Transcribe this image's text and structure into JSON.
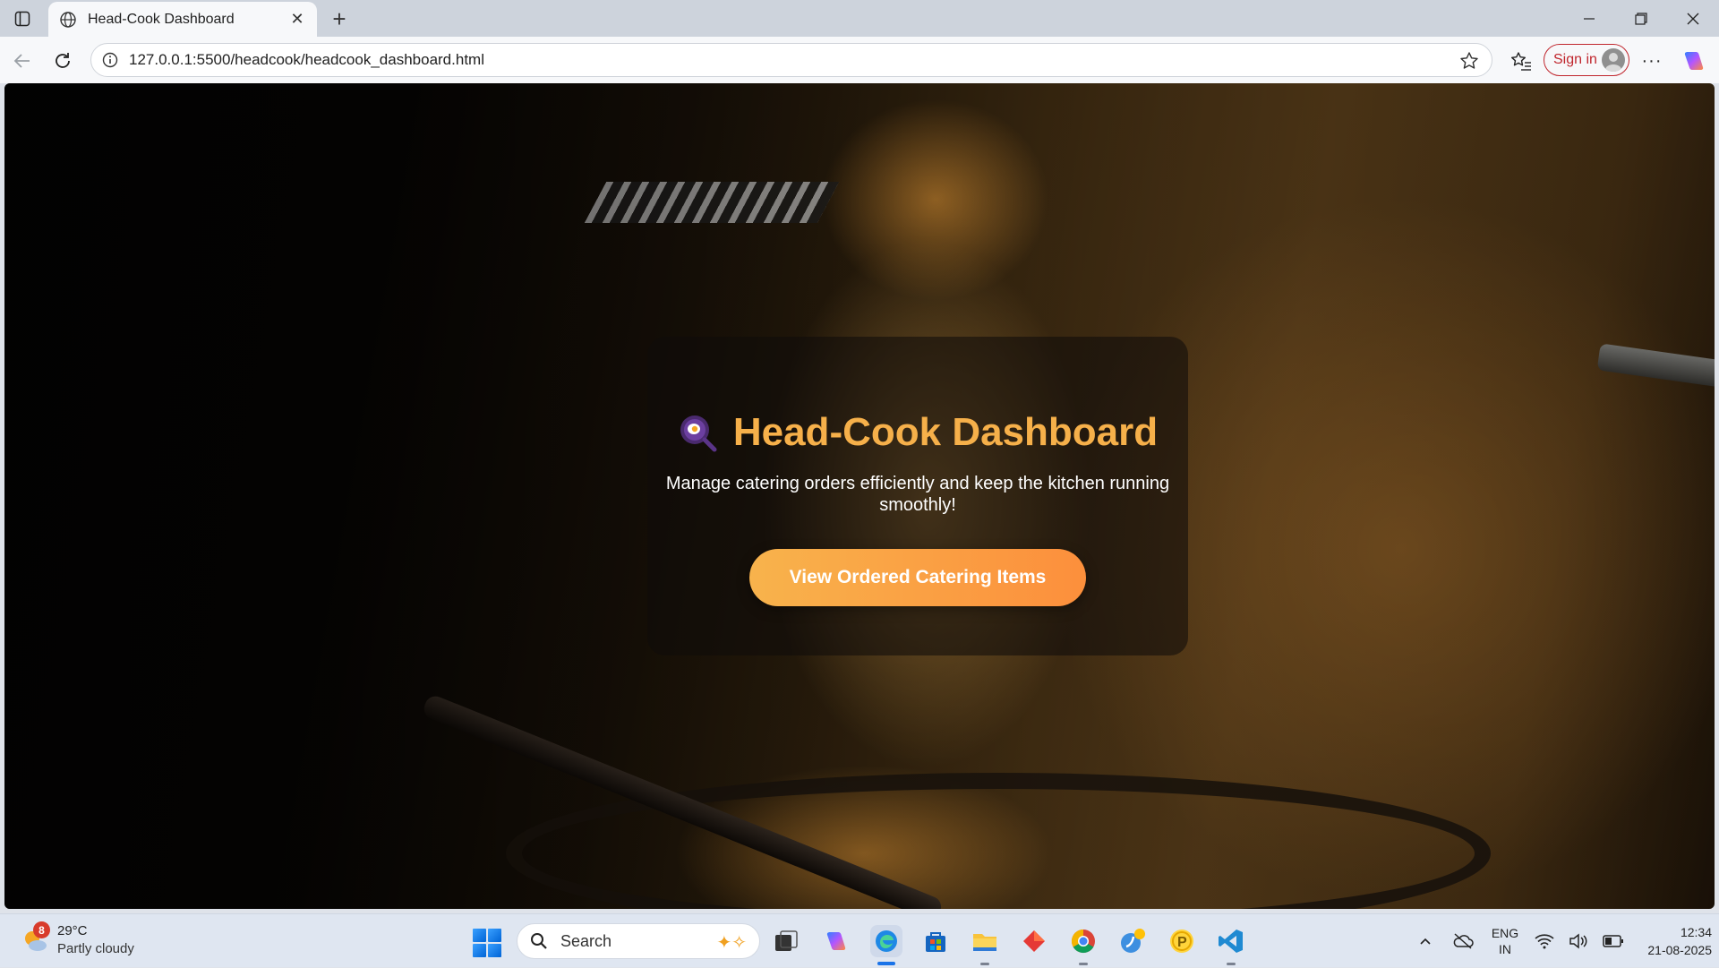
{
  "browser": {
    "tab_title": "Head-Cook Dashboard",
    "url": "127.0.0.1:5500/headcook/headcook_dashboard.html",
    "signin_label": "Sign in"
  },
  "hero": {
    "title": "Head-Cook Dashboard",
    "subtitle": "Manage catering orders efficiently and keep the kitchen running smoothly!",
    "button_label": "View Ordered Catering Items",
    "accent_color": "#f6b04a"
  },
  "taskbar": {
    "weather_badge": "8",
    "temperature": "29°C",
    "condition": "Partly cloudy",
    "search_label": "Search",
    "lang_top": "ENG",
    "lang_bottom": "IN",
    "time": "12:34",
    "date": "21-08-2025",
    "apps": [
      "task-view",
      "copilot",
      "edge",
      "store",
      "file-explorer",
      "app-red",
      "chrome",
      "app-blue",
      "app-yellow",
      "vscode"
    ]
  }
}
